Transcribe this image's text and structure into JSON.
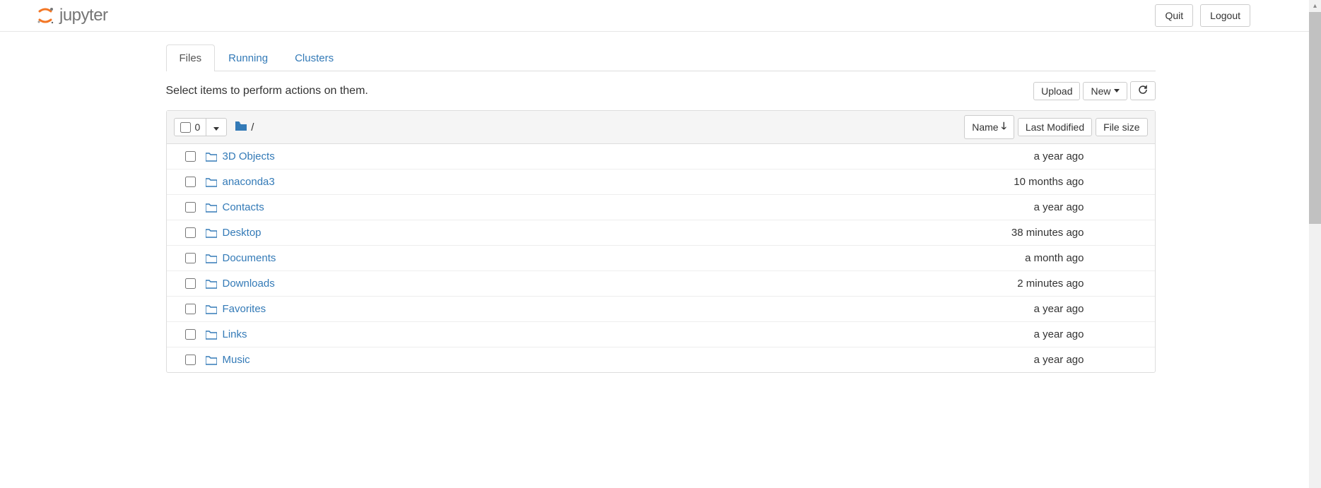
{
  "header": {
    "logo_text": "jupyter",
    "quit_label": "Quit",
    "logout_label": "Logout"
  },
  "tabs": {
    "files": "Files",
    "running": "Running",
    "clusters": "Clusters"
  },
  "toolbar": {
    "hint": "Select items to perform actions on them.",
    "upload_label": "Upload",
    "new_label": "New"
  },
  "list_header": {
    "selected_count": "0",
    "breadcrumb_sep": "/",
    "name_label": "Name",
    "modified_label": "Last Modified",
    "size_label": "File size"
  },
  "files": [
    {
      "name": "3D Objects",
      "modified": "a year ago",
      "size": ""
    },
    {
      "name": "anaconda3",
      "modified": "10 months ago",
      "size": ""
    },
    {
      "name": "Contacts",
      "modified": "a year ago",
      "size": ""
    },
    {
      "name": "Desktop",
      "modified": "38 minutes ago",
      "size": ""
    },
    {
      "name": "Documents",
      "modified": "a month ago",
      "size": ""
    },
    {
      "name": "Downloads",
      "modified": "2 minutes ago",
      "size": ""
    },
    {
      "name": "Favorites",
      "modified": "a year ago",
      "size": ""
    },
    {
      "name": "Links",
      "modified": "a year ago",
      "size": ""
    },
    {
      "name": "Music",
      "modified": "a year ago",
      "size": ""
    }
  ]
}
